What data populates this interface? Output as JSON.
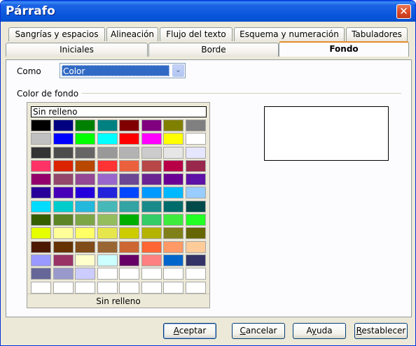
{
  "window": {
    "title": "Párrafo",
    "close_glyph": "✕"
  },
  "tabs_row1": [
    {
      "label": "Sangrías y espacios"
    },
    {
      "label": "Alineación"
    },
    {
      "label": "Flujo del texto"
    },
    {
      "label": "Esquema y numeración"
    },
    {
      "label": "Tabuladores"
    }
  ],
  "tabs_row2": [
    {
      "label": "Iniciales",
      "active": false
    },
    {
      "label": "Borde",
      "active": false
    },
    {
      "label": "Fondo",
      "active": true
    }
  ],
  "como": {
    "label": "Como",
    "value": "Color",
    "arrow_glyph": "⌄"
  },
  "color_group": {
    "label": "Color de fondo"
  },
  "palette": {
    "top_label": "Sin relleno",
    "footer_label": "Sin relleno",
    "colors": [
      [
        "#000000",
        "#000080",
        "#008000",
        "#008080",
        "#800000",
        "#800080",
        "#808000",
        "#808080"
      ],
      [
        "#c0c0c0",
        "#0000ff",
        "#00ff00",
        "#00ffff",
        "#ff0000",
        "#ff00ff",
        "#ffff00",
        "#ffffff"
      ],
      [
        "#333333",
        "#4d4d4d",
        "#666666",
        "#999999",
        "#b3b3b3",
        "#cccccc",
        "#e6e6e6",
        "#e6e6ff"
      ],
      [
        "#ff3366",
        "#dc2300",
        "#b84700",
        "#ff3333",
        "#eb613d",
        "#b84747",
        "#b80047",
        "#99284c"
      ],
      [
        "#94006b",
        "#94476b",
        "#944794",
        "#9966cc",
        "#6b4794",
        "#6b2394",
        "#6b0094",
        "#5e11a6"
      ],
      [
        "#280099",
        "#4700b8",
        "#2300dc",
        "#2323dc",
        "#0047ff",
        "#0099ff",
        "#00b8ff",
        "#99ccff"
      ],
      [
        "#00dcff",
        "#00cccc",
        "#23b8dc",
        "#47b8b8",
        "#33a3a3",
        "#198a8a",
        "#006b6b",
        "#004a4a"
      ],
      [
        "#355e00",
        "#5c8526",
        "#7da647",
        "#94bd5e",
        "#00ae00",
        "#33cc66",
        "#3deb3d",
        "#23ff23"
      ],
      [
        "#e6ff00",
        "#ffff99",
        "#ffff66",
        "#e6e64c",
        "#cccc00",
        "#b3b300",
        "#808019",
        "#666600"
      ],
      [
        "#4c1900",
        "#663300",
        "#804c19",
        "#996633",
        "#cc6633",
        "#ff6633",
        "#ff9966",
        "#ffcc99"
      ],
      [
        "#9999ff",
        "#993366",
        "#ffffcc",
        "#ccffff",
        "#660066",
        "#ff8080",
        "#0066cc",
        "#333366"
      ],
      [
        "#666699",
        "#9999cc",
        "#ccccff",
        "#ffffff",
        "#ffffff",
        "#ffffff",
        "#ffffff",
        "#ffffff"
      ],
      [
        "#ffffff",
        "#ffffff",
        "#ffffff",
        "#ffffff",
        "#ffffff",
        "#ffffff",
        "#ffffff",
        "#ffffff"
      ]
    ]
  },
  "preview": {
    "color": "#ffffff"
  },
  "buttons": {
    "accept": {
      "pre": "",
      "ul": "A",
      "post": "ceptar"
    },
    "cancel": {
      "pre": "",
      "ul": "C",
      "post": "ancelar"
    },
    "help": {
      "pre": "A",
      "ul": "y",
      "post": "uda"
    },
    "reset": {
      "pre": "",
      "ul": "R",
      "post": "establecer"
    }
  }
}
